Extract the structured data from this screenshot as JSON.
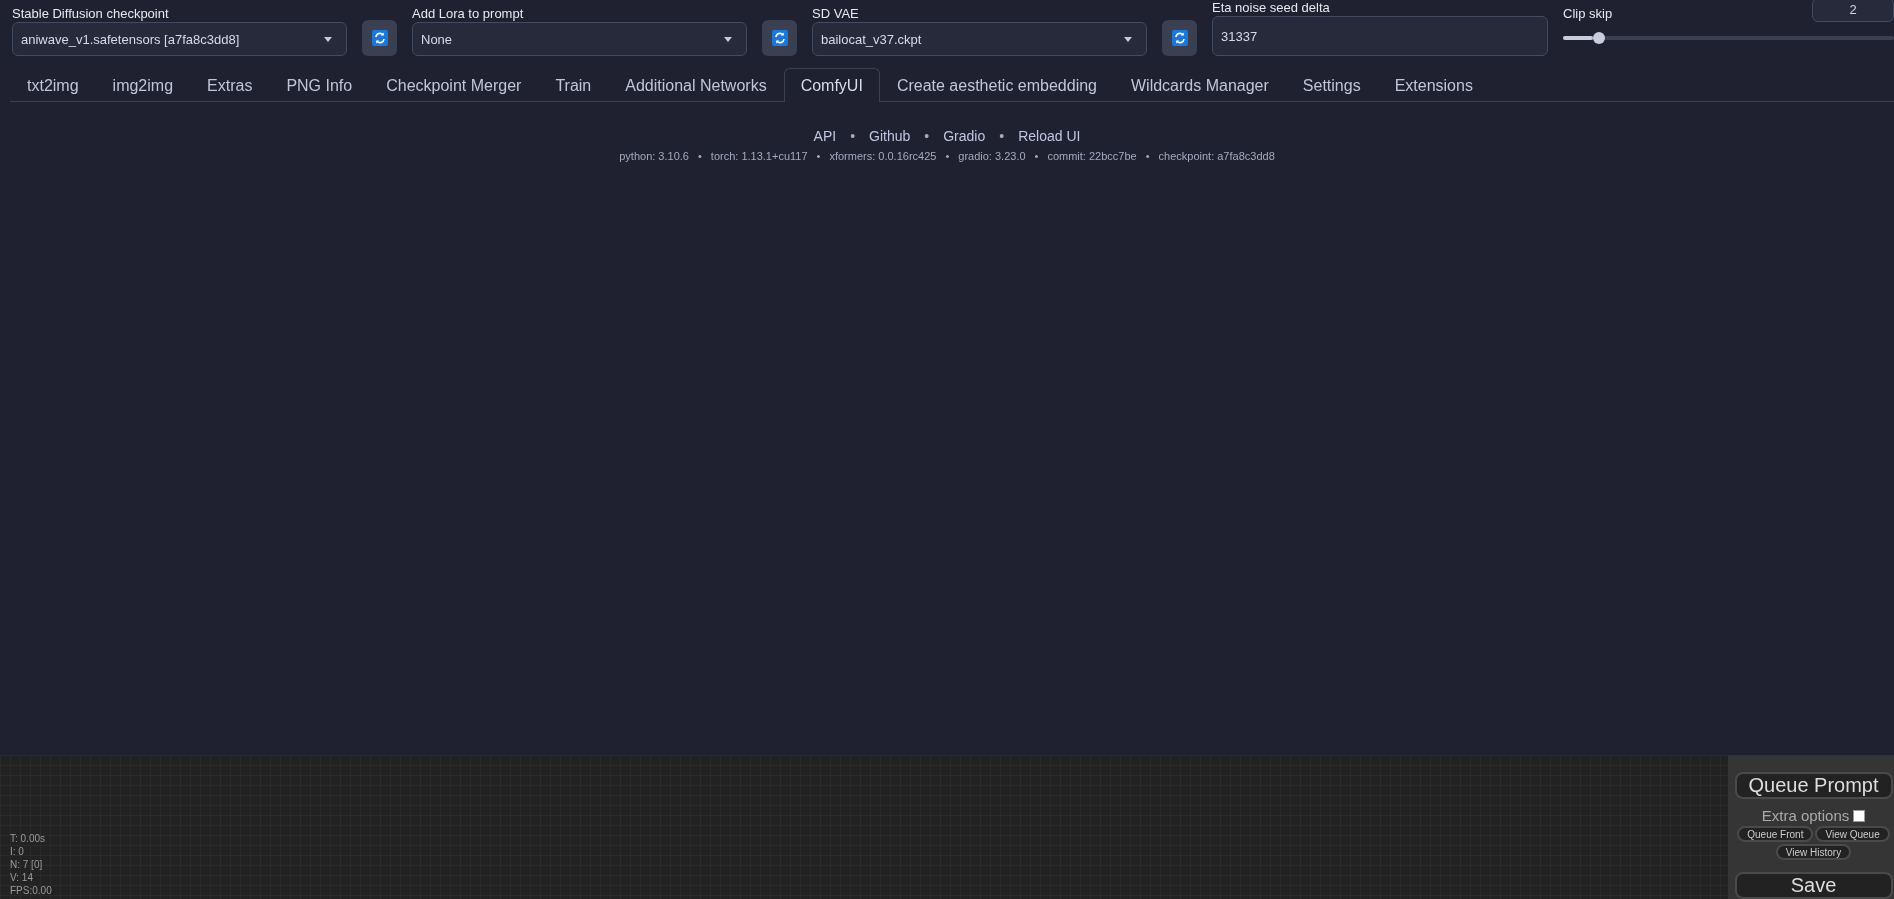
{
  "settings_bar": {
    "checkpoint": {
      "label": "Stable Diffusion checkpoint",
      "value": "aniwave_v1.safetensors [a7fa8c3dd8]"
    },
    "lora": {
      "label": "Add Lora to prompt",
      "value": "None"
    },
    "vae": {
      "label": "SD VAE",
      "value": "bailocat_v37.ckpt"
    },
    "eta_noise_seed_delta": {
      "label": "Eta noise seed delta",
      "value": "31337"
    },
    "clip_skip": {
      "label": "Clip skip",
      "value": "2",
      "level": 0.09
    }
  },
  "tabs": [
    {
      "label": "txt2img",
      "selected": false
    },
    {
      "label": "img2img",
      "selected": false
    },
    {
      "label": "Extras",
      "selected": false
    },
    {
      "label": "PNG Info",
      "selected": false
    },
    {
      "label": "Checkpoint Merger",
      "selected": false
    },
    {
      "label": "Train",
      "selected": false
    },
    {
      "label": "Additional Networks",
      "selected": false
    },
    {
      "label": "ComfyUI",
      "selected": true
    },
    {
      "label": "Create aesthetic embedding",
      "selected": false
    },
    {
      "label": "Wildcards Manager",
      "selected": false
    },
    {
      "label": "Settings",
      "selected": false
    },
    {
      "label": "Extensions",
      "selected": false
    }
  ],
  "footer": {
    "links": [
      "API",
      "Github",
      "Gradio",
      "Reload UI"
    ],
    "versions": [
      "python: 3.10.6",
      "torch: 1.13.1+cu117",
      "xformers: 0.0.16rc425",
      "gradio: 3.23.0",
      "commit: 22bcc7be",
      "checkpoint: a7fa8c3dd8"
    ],
    "separator": "•"
  },
  "comfy": {
    "stats": [
      "T: 0.00s",
      "I: 0",
      "N: 7 [0]",
      "V: 14",
      "FPS:0.00"
    ],
    "menu": {
      "queue_prompt": "Queue Prompt",
      "extra_options": {
        "label": "Extra options",
        "checked": false
      },
      "queue_front": "Queue Front",
      "view_queue": "View Queue",
      "view_history": "View History",
      "save": "Save"
    }
  }
}
